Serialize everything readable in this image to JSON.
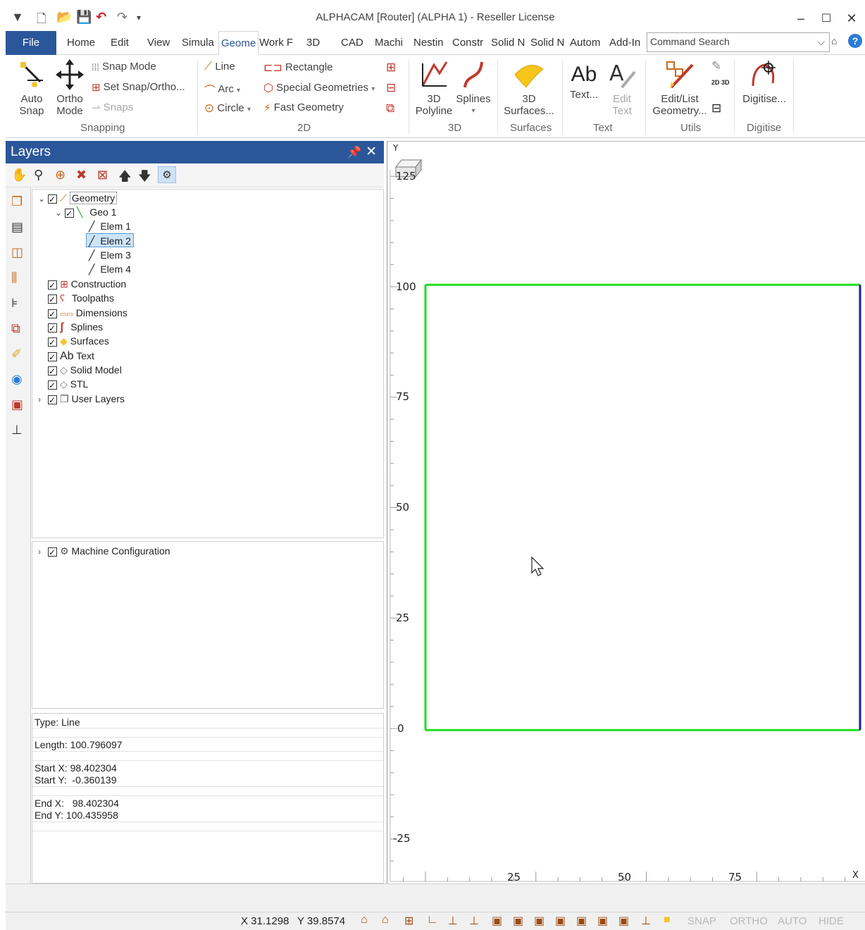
{
  "window": {
    "title": "ALPHACAM [Router] (ALPHA 1)  - Reseller License",
    "quick_access_icons": [
      "pin-icon",
      "new-file-icon",
      "open-folder-icon",
      "save-icon",
      "undo-icon",
      "redo-icon",
      "customize-icon"
    ],
    "controls": [
      "minimize-icon",
      "maximize-icon",
      "close-icon"
    ]
  },
  "ribbon_tabs": [
    "File",
    "Home",
    "Edit",
    "View",
    "Simula",
    "Geome",
    "Work F",
    "3D",
    "CAD",
    "Machi",
    "Nestin",
    "Constr",
    "Solid N",
    "Solid N",
    "Autom",
    "Add-In"
  ],
  "active_tab": "Geome",
  "command_search": {
    "placeholder": "Command Search"
  },
  "ribbon": {
    "snapping": {
      "label": "Snapping",
      "auto_snap": "Auto\nSnap",
      "ortho_mode": "Ortho\nMode",
      "snap_mode": "Snap Mode",
      "set_snap": "Set Snap/Ortho...",
      "snaps": "Snaps"
    },
    "two_d": {
      "label": "2D",
      "line": "Line",
      "arc": "Arc",
      "circle": "Circle",
      "rectangle": "Rectangle",
      "special": "Special Geometries",
      "fast": "Fast Geometry"
    },
    "three_d": {
      "label": "3D",
      "polyline": "3D\nPolyline",
      "splines": "Splines"
    },
    "surfaces": {
      "label": "Surfaces",
      "surfaces3d": "3D\nSurfaces..."
    },
    "text": {
      "label": "Text",
      "text": "Text...",
      "edit_text": "Edit\nText",
      "ab": "Ab"
    },
    "utils": {
      "label": "Utils",
      "edit_list": "Edit/List\nGeometry...",
      "twod3d": "2D 3D"
    },
    "digitise": {
      "label": "Digitise",
      "digitise": "Digitise..."
    }
  },
  "layers_panel": {
    "title": "Layers",
    "tree": [
      {
        "label": "Geometry",
        "level": 0,
        "expanded": true
      },
      {
        "label": "Geo 1",
        "level": 1,
        "expanded": true
      },
      {
        "label": "Elem 1",
        "level": 2
      },
      {
        "label": "Elem 2",
        "level": 2,
        "selected": true
      },
      {
        "label": "Elem 3",
        "level": 2
      },
      {
        "label": "Elem 4",
        "level": 2
      },
      {
        "label": "Construction",
        "level": 0
      },
      {
        "label": "Toolpaths",
        "level": 0
      },
      {
        "label": "Dimensions",
        "level": 0
      },
      {
        "label": "Splines",
        "level": 0
      },
      {
        "label": "Surfaces",
        "level": 0
      },
      {
        "label": "Text",
        "level": 0,
        "prefix": "Ab"
      },
      {
        "label": "Solid Model",
        "level": 0
      },
      {
        "label": "STL",
        "level": 0
      },
      {
        "label": "User Layers",
        "level": 0,
        "collapsed": true
      }
    ],
    "machine_config": "Machine Configuration"
  },
  "info": {
    "type": "Type: Line",
    "length": "Length: 100.796097",
    "start_x": "Start X: 98.402304",
    "start_y": "Start Y:  -0.360139",
    "end_x": "End X:   98.402304",
    "end_y": "End Y: 100.435958"
  },
  "viewport": {
    "y_axis_label": "Y",
    "x_axis_label": "X",
    "y_ticks": [
      "125",
      "100",
      "75",
      "50",
      "25",
      "0",
      "-25"
    ],
    "x_ticks": [
      "25",
      "50",
      "75"
    ],
    "rectangle": {
      "x_min": 0,
      "x_max": 98.4,
      "y_min": -0.36,
      "y_max": 100.44
    },
    "colors": {
      "geometry": "#22dd22",
      "selected": "#1c1ca8"
    }
  },
  "status": {
    "x": "X 31.1298",
    "y": "Y 39.8574",
    "toggles": [
      "SNAP",
      "ORTHO",
      "AUTO",
      "HIDE"
    ]
  }
}
